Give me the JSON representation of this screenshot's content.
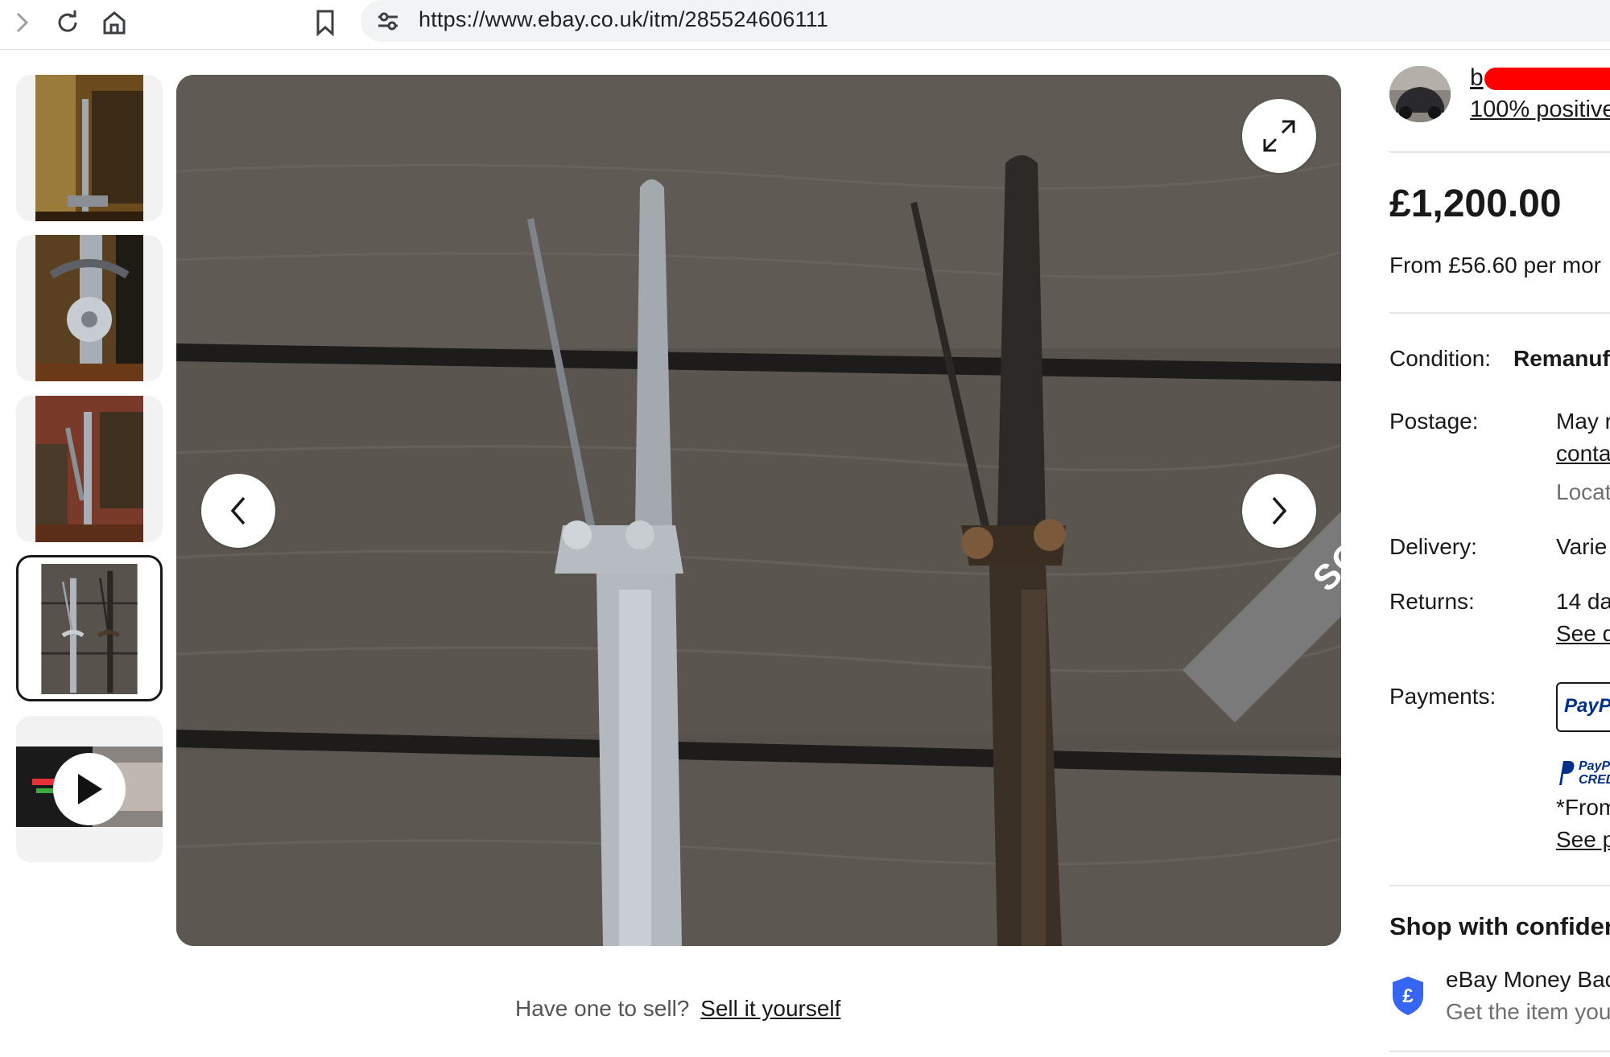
{
  "browser": {
    "url": "https://www.ebay.co.uk/itm/285524606111"
  },
  "listing": {
    "sold_badge": "SOLD",
    "sell_prompt": "Have one to sell?",
    "sell_link": "Sell it yourself"
  },
  "seller": {
    "name": "b",
    "feedback": "100% positive"
  },
  "price": {
    "amount": "£1,200.00",
    "per_month": "From £56.60 per mor"
  },
  "details": {
    "condition_label": "Condition:",
    "condition_value": "Remanufa",
    "postage_label": "Postage:",
    "postage_value": "May r",
    "postage_link": "conta",
    "location_value": "Locat",
    "delivery_label": "Delivery:",
    "delivery_value": "Varie",
    "returns_label": "Returns:",
    "returns_value": "14 da",
    "returns_link": "See d",
    "payments_label": "Payments:",
    "paypal_text": "PayP",
    "paypal_credit_text": "PayP CRED",
    "from_text": "*From",
    "see_link": "See p"
  },
  "confidence": {
    "title": "Shop with confiden",
    "money_back_title": "eBay Money Bac",
    "money_back_sub": "Get the item you"
  },
  "colors": {
    "text": "#191919",
    "muted": "#707070",
    "paypal_blue": "#003087",
    "shield_blue": "#3665f3"
  }
}
